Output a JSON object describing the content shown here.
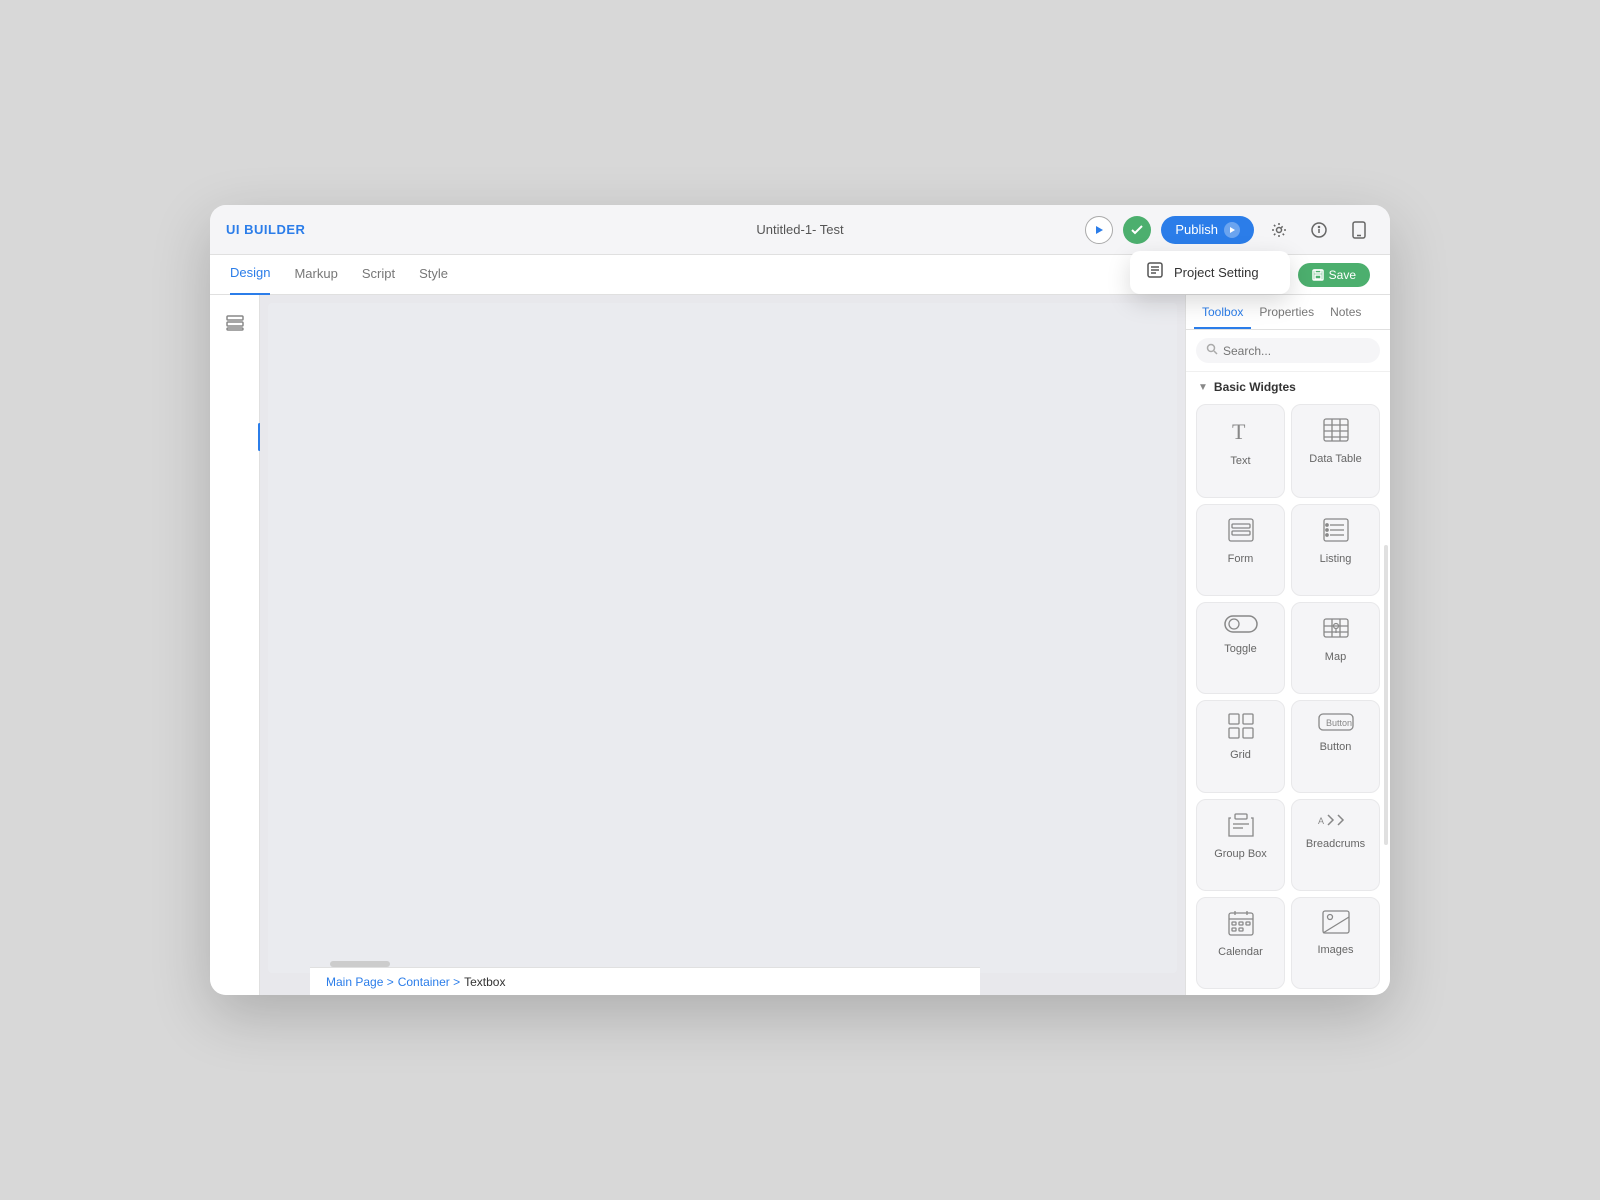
{
  "app": {
    "title": "UI BUILDER",
    "document_title": "Untitled-1- Test"
  },
  "header": {
    "publish_label": "Publish",
    "project_setting_label": "Project Setting"
  },
  "tabs": {
    "items": [
      {
        "label": "Design",
        "active": true
      },
      {
        "label": "Markup",
        "active": false
      },
      {
        "label": "Script",
        "active": false
      },
      {
        "label": "Style",
        "active": false
      }
    ],
    "save_label": "Save"
  },
  "right_panel": {
    "tabs": [
      {
        "label": "Toolbox",
        "active": true
      },
      {
        "label": "Properties",
        "active": false
      },
      {
        "label": "Notes",
        "active": false
      }
    ],
    "search_placeholder": "Search...",
    "section_title": "Basic Widgtes",
    "widgets": [
      {
        "id": "text",
        "label": "Text",
        "icon": "T"
      },
      {
        "id": "data-table",
        "label": "Data Table",
        "icon": "table"
      },
      {
        "id": "form",
        "label": "Form",
        "icon": "form"
      },
      {
        "id": "listing",
        "label": "Listing",
        "icon": "listing"
      },
      {
        "id": "toggle",
        "label": "Toggle",
        "icon": "toggle"
      },
      {
        "id": "map",
        "label": "Map",
        "icon": "map"
      },
      {
        "id": "grid",
        "label": "Grid",
        "icon": "grid"
      },
      {
        "id": "button",
        "label": "Button",
        "icon": "button"
      },
      {
        "id": "group-box",
        "label": "Group Box",
        "icon": "group-box"
      },
      {
        "id": "breadcrums",
        "label": "Breadcrums",
        "icon": "breadcrums"
      },
      {
        "id": "calendar",
        "label": "Calendar",
        "icon": "calendar"
      },
      {
        "id": "images",
        "label": "Images",
        "icon": "images"
      }
    ]
  },
  "breadcrumb": {
    "main": "Main Page >",
    "container": "Container >",
    "current": "Textbox"
  }
}
